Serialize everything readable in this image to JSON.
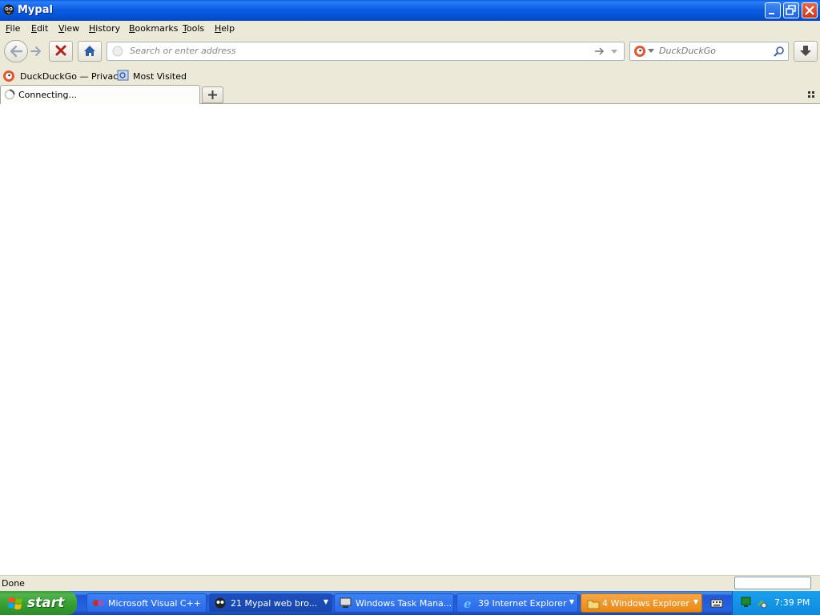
{
  "window": {
    "title": "Mypal"
  },
  "menu": [
    "File",
    "Edit",
    "View",
    "History",
    "Bookmarks",
    "Tools",
    "Help"
  ],
  "menu_underline": [
    "F",
    "E",
    "V",
    "H",
    "B",
    "T",
    "H"
  ],
  "toolbar": {
    "address_placeholder": "Search or enter address",
    "search_placeholder": "DuckDuckGo"
  },
  "bookmarks": [
    {
      "label": "DuckDuckGo — Privac...",
      "icon": "duckduckgo-icon"
    },
    {
      "label": "Most Visited",
      "icon": "folder-icon"
    }
  ],
  "tabs": [
    {
      "label": "Connecting...",
      "icon": "loading-spinner-icon"
    }
  ],
  "status": {
    "text": "Done"
  },
  "taskbar": {
    "start_label": "start",
    "tasks": [
      {
        "label": "Microsoft Visual C++",
        "active": false
      },
      {
        "label": "21 Mypal web bro...",
        "active": true
      },
      {
        "label": "Windows Task Mana...",
        "active": false
      },
      {
        "label": "39 Internet Explorer",
        "active": false
      },
      {
        "label": "4 Windows Explorer",
        "active": false
      }
    ],
    "clock": "7:39 PM"
  },
  "colors": {
    "titlebar": "#0b5ce4",
    "taskbar": "#2663e0",
    "start": "#37a132",
    "close": "#c4381f"
  }
}
